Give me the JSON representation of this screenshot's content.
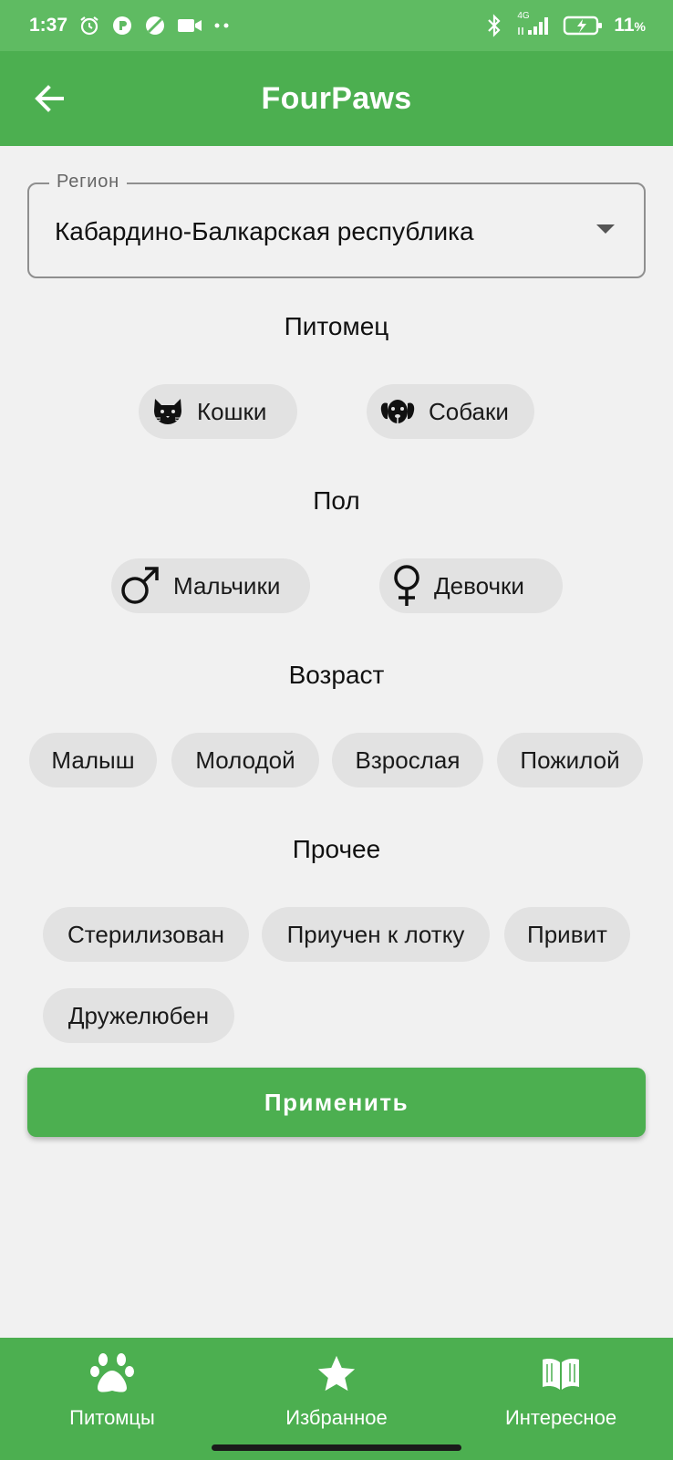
{
  "status_bar": {
    "time": "1:37",
    "network": "4G",
    "battery": "11",
    "battery_unit": "%"
  },
  "app_bar": {
    "title": "FourPaws"
  },
  "region": {
    "label": "Регион",
    "value": "Кабардино-Балкарская республика"
  },
  "pet": {
    "title": "Питомец",
    "options": [
      {
        "label": "Кошки",
        "icon": "cat-icon"
      },
      {
        "label": "Собаки",
        "icon": "dog-icon"
      }
    ]
  },
  "sex": {
    "title": "Пол",
    "options": [
      {
        "label": "Мальчики",
        "icon": "male-icon"
      },
      {
        "label": "Девочки",
        "icon": "female-icon"
      }
    ]
  },
  "age": {
    "title": "Возраст",
    "options": [
      "Малыш",
      "Молодой",
      "Взрослая",
      "Пожилой"
    ]
  },
  "other": {
    "title": "Прочее",
    "options": [
      "Стерилизован",
      "Приучен к лотку",
      "Привит",
      "Дружелюбен"
    ]
  },
  "apply_button": "Применить",
  "bottom_nav": [
    {
      "label": "Питомцы",
      "icon": "paw-icon"
    },
    {
      "label": "Избранное",
      "icon": "star-icon"
    },
    {
      "label": "Интересное",
      "icon": "book-icon"
    }
  ],
  "colors": {
    "primary": "#4caf50",
    "status_bar": "#5fbb62",
    "background": "#f1f1f1",
    "chip": "#e2e2e2"
  }
}
